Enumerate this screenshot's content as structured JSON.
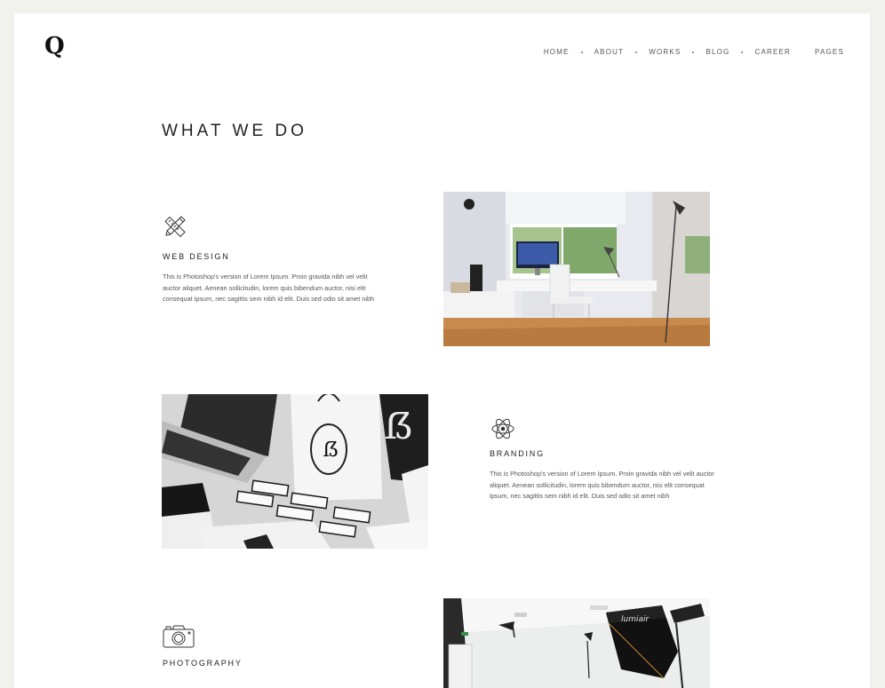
{
  "brand": {
    "logo": "Q"
  },
  "nav": {
    "items": [
      {
        "label": "HOME"
      },
      {
        "label": "ABOUT"
      },
      {
        "label": "WORKS"
      },
      {
        "label": "BLOG"
      },
      {
        "label": "CAREER"
      },
      {
        "label": "PAGES"
      }
    ]
  },
  "page": {
    "title": "WHAT WE DO"
  },
  "features": [
    {
      "icon": "pencil-ruler-icon",
      "heading": "WEB DESIGN",
      "text": "This is Photoshop's version  of Lorem Ipsum. Proin gravida nibh vel velit auctor aliquet. Aenean sollicitudin, lorem quis bibendum auctor, nisi elit consequat ipsum, nec sagittis sem nibh id elit. Duis sed odio sit amet nibh",
      "image": "workspace-photo"
    },
    {
      "icon": "atom-icon",
      "heading": "BRANDING",
      "text": "This is Photoshop's version  of Lorem Ipsum. Proin gravida nibh vel velit auctor aliquet. Aenean sollicitudin, lorem quis bibendum auctor, nisi elit consequat ipsum, nec sagittis sem nibh id elit. Duis sed odio sit amet nibh",
      "image": "stationery-photo"
    },
    {
      "icon": "camera-icon",
      "heading": "PHOTOGRAPHY",
      "image": "studio-photo"
    }
  ],
  "colors": {
    "background": "#f1f1ed",
    "card": "#ffffff",
    "text": "#222222",
    "muted": "#555555"
  }
}
